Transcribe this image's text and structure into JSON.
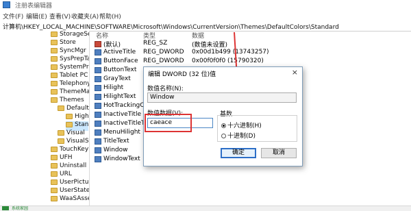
{
  "window": {
    "title": "注册表编辑器"
  },
  "menu": [
    "文件(F)",
    "编辑(E)",
    "查看(V)",
    "收藏夹(A)",
    "帮助(H)"
  ],
  "address": "计算机\\HKEY_LOCAL_MACHINE\\SOFTWARE\\Microsoft\\Windows\\CurrentVersion\\Themes\\DefaultColors\\Standard",
  "tree": [
    "StorageSe",
    "Store",
    "SyncMgr",
    "SysPrepTa",
    "SystemPrc",
    "Tablet PC",
    "Telephony",
    "ThemeMa",
    "Themes",
    "Default",
    "High",
    "Stan",
    "Visual",
    "VisualSt",
    "TouchKeyl",
    "UFH",
    "Uninstall",
    "URL",
    "UserPictur",
    "UserState",
    "WaaSAsse"
  ],
  "columns": {
    "name": "名称",
    "type": "类型",
    "data": "数据"
  },
  "values": [
    {
      "name": "(默认)",
      "type": "REG_SZ",
      "data": "(数值未设置)"
    },
    {
      "name": "ActiveTitle",
      "type": "REG_DWORD",
      "data": "0x00d1b499 (13743257)"
    },
    {
      "name": "ButtonFace",
      "type": "REG_DWORD",
      "data": "0x00f0f0f0 (15790320)"
    },
    {
      "name": "ButtonText",
      "type": "",
      "data": ""
    },
    {
      "name": "GrayText",
      "type": "",
      "data": ""
    },
    {
      "name": "Hilight",
      "type": "",
      "data": ""
    },
    {
      "name": "HilightText",
      "type": "",
      "data": ""
    },
    {
      "name": "HotTrackingCo...",
      "type": "",
      "data": ""
    },
    {
      "name": "InactiveTitle",
      "type": "",
      "data": ""
    },
    {
      "name": "InactiveTitleText",
      "type": "",
      "data": ""
    },
    {
      "name": "MenuHilight",
      "type": "",
      "data": ""
    },
    {
      "name": "TitleText",
      "type": "",
      "data": ""
    },
    {
      "name": "Window",
      "type": "",
      "data": ""
    },
    {
      "name": "WindowText",
      "type": "",
      "data": ""
    }
  ],
  "dialog": {
    "title": "编辑 DWORD (32 位)值",
    "close": "×",
    "name_label": "数值名称(N):",
    "name_value": "Window",
    "data_label": "数值数据(V):",
    "data_value": "caeace",
    "base_label": "基数",
    "radio_hex": "十六进制(H)",
    "radio_dec": "十进制(D)",
    "radio_selected": "hex",
    "ok": "确定",
    "cancel": "取消"
  },
  "status": {
    "badge_color": "#2c8a3a",
    "text": "系统家园"
  },
  "colors": {
    "annotation": "#dd3333",
    "accent": "#2c6ec7"
  }
}
